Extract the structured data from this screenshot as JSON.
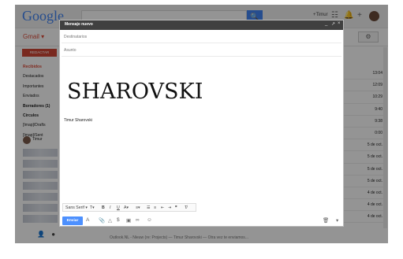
{
  "gmail": {
    "logo": "Google",
    "label": "Gmail ▾",
    "user": "+Timur",
    "search_icon": "search-icon",
    "compose": "REDACTAR",
    "nav": [
      {
        "label": "Recibidos",
        "style": "active"
      },
      {
        "label": "Destacados",
        "style": ""
      },
      {
        "label": "Importantes",
        "style": ""
      },
      {
        "label": "Enviados",
        "style": ""
      },
      {
        "label": "Borradores (1)",
        "style": "bold"
      },
      {
        "label": "Círculos",
        "style": "bold"
      },
      {
        "label": "[Imap]/Drafts",
        "style": ""
      },
      {
        "label": "[Imap]/Sent",
        "style": ""
      }
    ],
    "user_side": "Timur",
    "rows": [
      {
        "date": "13:04",
        "mark": "sp"
      },
      {
        "date": "12:09",
        "mark": ""
      },
      {
        "date": "10:29",
        "mark": ""
      },
      {
        "date": "9:40",
        "mark": "ds"
      },
      {
        "date": "9:38",
        "mark": ""
      },
      {
        "date": "0:00",
        "mark": "G"
      },
      {
        "date": "5 de oct.",
        "mark": ""
      },
      {
        "date": "5 de oct.",
        "mark": ""
      },
      {
        "date": "5 de oct.",
        "mark": ""
      },
      {
        "date": "5 de oct.",
        "mark": ""
      },
      {
        "date": "4 de oct.",
        "mark": ""
      },
      {
        "date": "4 de oct.",
        "mark": ""
      },
      {
        "date": "4 de oct.",
        "mark": ""
      }
    ],
    "bottom_text": "Outlook.NL - Nieuw (re: Projects) — Timur Sharovski — Otra vez te enviamos..."
  },
  "compose": {
    "title": "Mensaje nuevo",
    "to_placeholder": "Destinatarios",
    "subject_placeholder": "Asunto",
    "big_text": "SHAROVSKI",
    "signature": "Timur Sharovski",
    "font": "Sans Serif",
    "send": "Enviar"
  }
}
